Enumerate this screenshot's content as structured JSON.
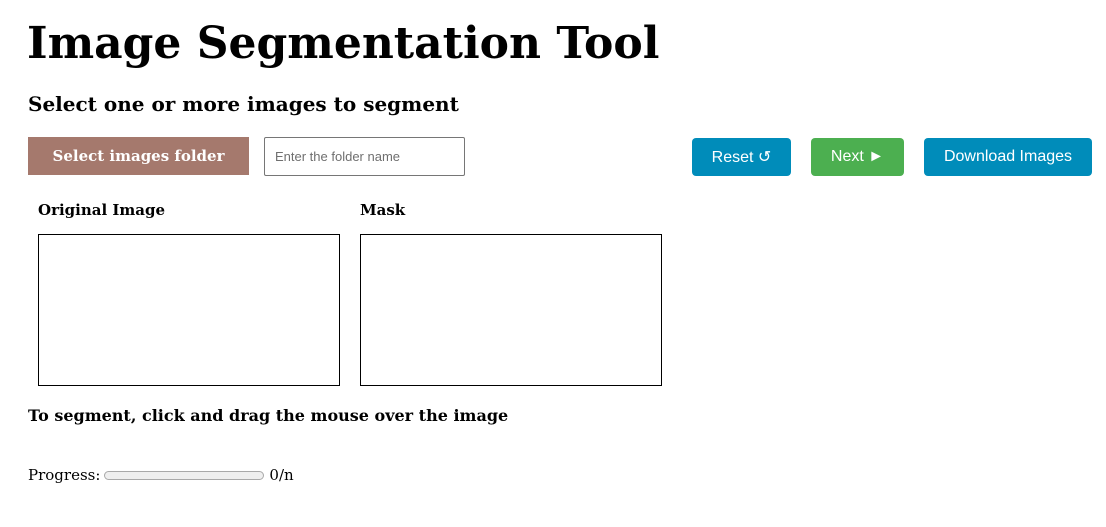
{
  "header": {
    "title": "Image Segmentation Tool",
    "subtitle": "Select one or more images to segment"
  },
  "toolbar": {
    "select_folder_label": "Select images folder",
    "folder_input_value": "",
    "folder_input_placeholder": "Enter the folder name",
    "reset_label": "Reset ↺",
    "next_label": "Next ►",
    "download_label": "Download Images"
  },
  "panels": {
    "original_label": "Original Image",
    "mask_label": "Mask"
  },
  "instructions": "To segment, click and drag the mouse over the image",
  "progress": {
    "label": "Progress:",
    "value": 0,
    "text": "0/n"
  },
  "colors": {
    "select_folder_bg": "#a5796d",
    "reset_bg": "#008cba",
    "next_bg": "#4caf50",
    "download_bg": "#008cba",
    "progress_fill": "#4caf50"
  }
}
